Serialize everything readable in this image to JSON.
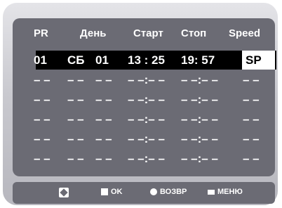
{
  "headers": [
    "PR",
    "День",
    "Старт",
    "Стоп",
    "Speed"
  ],
  "rows": [
    {
      "pr": "01",
      "day": "СБ",
      "date": "01",
      "start": "13 : 25",
      "stop": "19: 57",
      "speed": "SP"
    },
    {
      "pr": "– –",
      "day": "– –",
      "date": "– –",
      "start": "– –:– –",
      "stop": "– –:– –",
      "speed": "– –"
    },
    {
      "pr": "– –",
      "day": "– –",
      "date": "– –",
      "start": "– –:– –",
      "stop": "– –:– –",
      "speed": "– –"
    },
    {
      "pr": "– –",
      "day": "– –",
      "date": "– –",
      "start": "– –:– –",
      "stop": "– –:– –",
      "speed": "– –"
    },
    {
      "pr": "– –",
      "day": "– –",
      "date": "– –",
      "start": "– –:– –",
      "stop": "– –:– –",
      "speed": "– –"
    },
    {
      "pr": "– –",
      "day": "– –",
      "date": "– –",
      "start": "– –:– –",
      "stop": "– –:– –",
      "speed": "– –"
    }
  ],
  "footer": {
    "nav_icon": "navigation-icon",
    "ok_label": "OK",
    "back_label": "ВОЗВР",
    "menu_label": "МЕНЮ"
  }
}
